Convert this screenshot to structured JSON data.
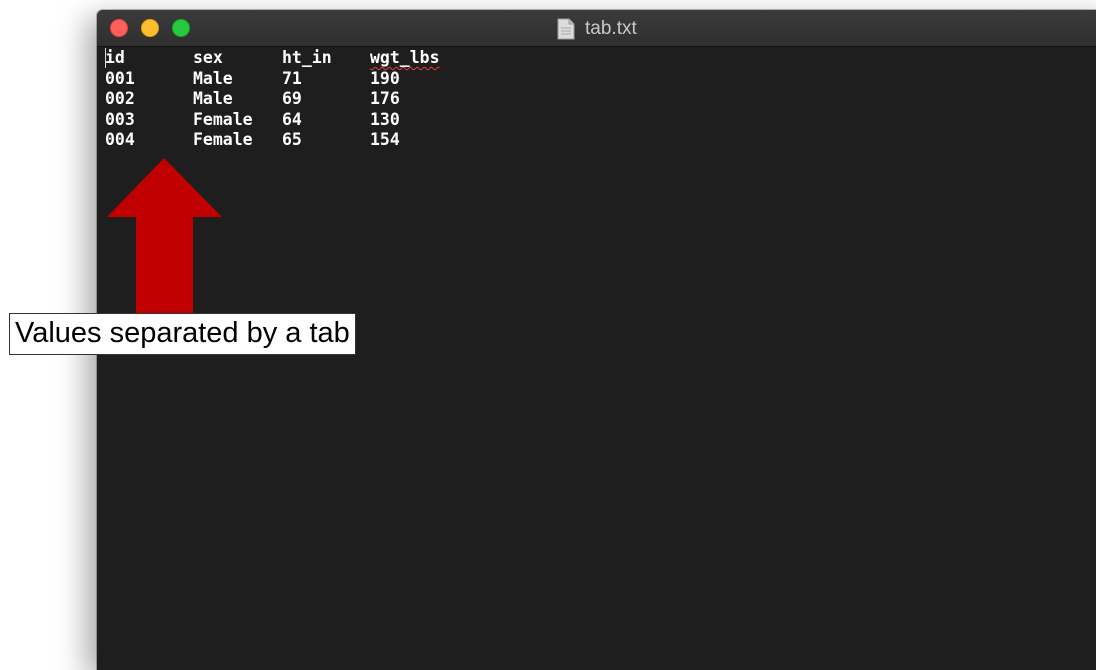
{
  "window": {
    "title": "tab.txt"
  },
  "file": {
    "header": [
      "id",
      "sex",
      "ht_in",
      "wgt_lbs"
    ],
    "rows": [
      [
        "001",
        "Male",
        "71",
        "190"
      ],
      [
        "002",
        "Male",
        "69",
        "176"
      ],
      [
        "003",
        "Female",
        "64",
        "130"
      ],
      [
        "004",
        "Female",
        "65",
        "154"
      ]
    ]
  },
  "annotation": {
    "label": "Values separated by a tab",
    "arrow_color": "#c00000"
  },
  "colors": {
    "editor_background": "#1e1e1e",
    "text": "#ffffff",
    "close": "#fe5f57",
    "minimize": "#febc2e",
    "zoom": "#28c840"
  },
  "icons": {
    "title_icon": "document-icon"
  }
}
